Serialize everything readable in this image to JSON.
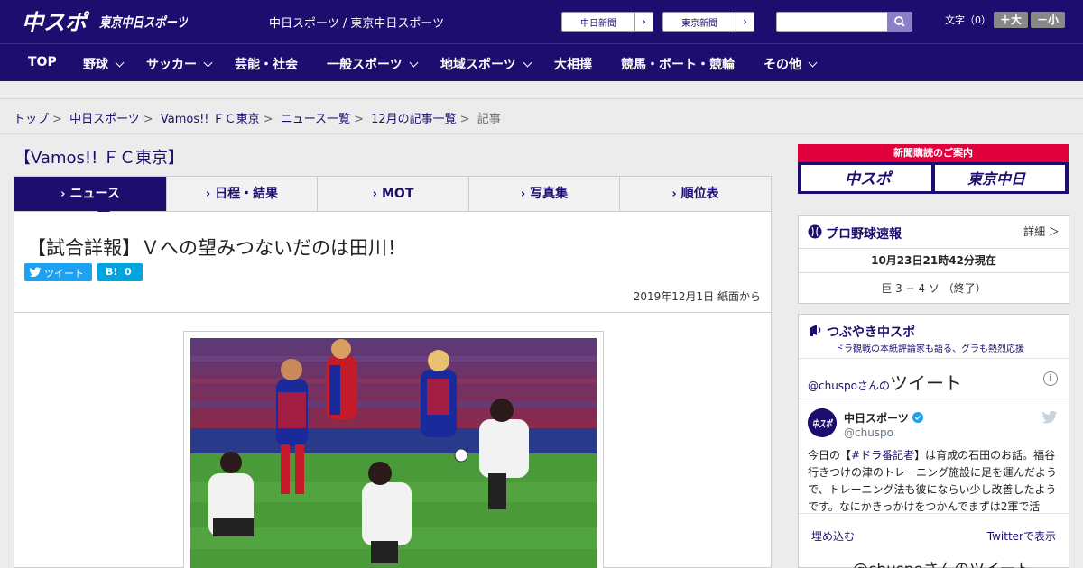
{
  "header": {
    "logo_chuspo": "中スポ",
    "logo_tokyo": "東京中日スポーツ",
    "site_title": "中日スポーツ / 東京中日スポーツ",
    "link_chunichi": "中日新聞",
    "link_tokyo": "東京新聞",
    "search_placeholder": "",
    "fontsize_label": "文字（0）",
    "font_larger": "＋大",
    "font_smaller": "－小"
  },
  "nav": [
    {
      "label": "TOP",
      "dropdown": false
    },
    {
      "label": "野球",
      "dropdown": true
    },
    {
      "label": "サッカー",
      "dropdown": true
    },
    {
      "label": "芸能・社会",
      "dropdown": false
    },
    {
      "label": "一般スポーツ",
      "dropdown": true
    },
    {
      "label": "地域スポーツ",
      "dropdown": true
    },
    {
      "label": "大相撲",
      "dropdown": false
    },
    {
      "label": "競馬・ボート・競輪",
      "dropdown": false
    },
    {
      "label": "その他",
      "dropdown": true
    }
  ],
  "breadcrumb": [
    "トップ",
    "中日スポーツ",
    "Vamos!! ＦＣ東京",
    "ニュース一覧",
    "12月の記事一覧",
    "記事"
  ],
  "section_title": "【Vamos!! ＦＣ東京】",
  "tabs": [
    "ニュース",
    "日程・結果",
    "MOT",
    "写真集",
    "順位表"
  ],
  "article": {
    "headline": "【試合詳報】Ｖへの望みつないだのは田川！",
    "tweet_label": "ツイート",
    "hatena_label": "B!",
    "hatena_count": "0",
    "dateline": "2019年12月1日 紙面から"
  },
  "sidebar": {
    "subscription_title": "新聞購読のご案内",
    "subscription_chuspo": "中スポ",
    "subscription_tokyo": "東京中日",
    "baseball": {
      "title": "プロ野球速報",
      "more": "詳細 ＞",
      "time": "10月23日21時42分現在",
      "score": "巨 3 − 4 ソ （終了）"
    },
    "tweets": {
      "title": "つぶやき中スポ",
      "subtitle": "ドラ観戦の本紙評論家も語る、グラも熱烈応援",
      "timeline_handle": "@chuspo",
      "timeline_san": "さんの",
      "timeline_word": "ツイート",
      "author_name": "中日スポーツ",
      "author_handle": "@chuspo",
      "text_prefix": "今日の【",
      "text_tag": "#ドラ番記者",
      "text_body": "】は育成の石田のお話。福谷行きつけの津のトレーニング施設に足を運んだようで、トレーニング法も彼にならい少し改善したようです。なにかきっかけをつかんでまずは2軍で活",
      "embed_label": "埋め込む",
      "view_label": "Twitterで表示",
      "bottom_heading": "@chuspoさんのツイート"
    }
  },
  "colors": {
    "brand": "#1d0d6e",
    "accent_red": "#e0003b",
    "twitter": "#1da1f2",
    "hatena": "#00a4de"
  }
}
